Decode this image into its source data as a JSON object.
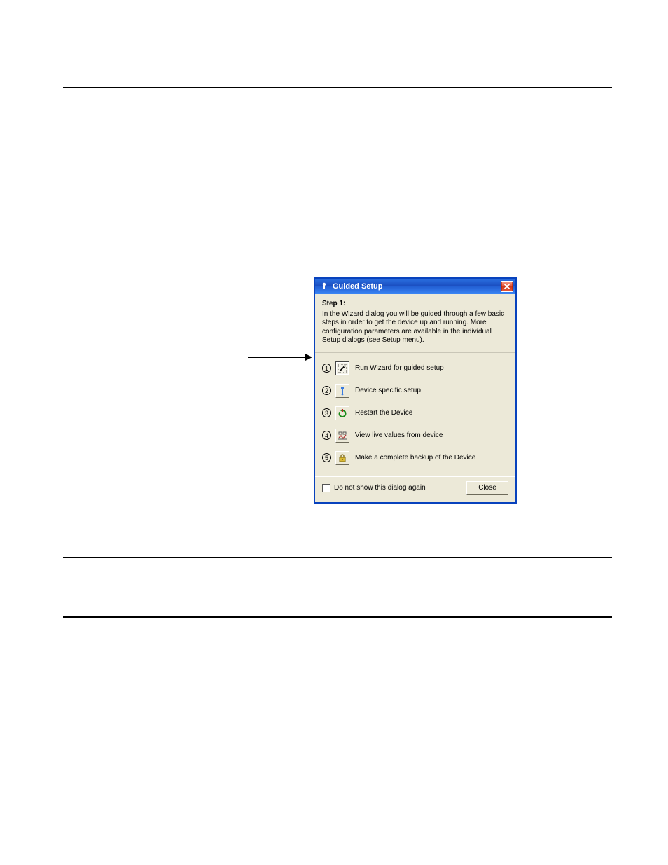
{
  "dialog": {
    "title": "Guided Setup",
    "intro": {
      "heading": "Step 1:",
      "text": "In the Wizard dialog you will be guided through a few basic steps in order to get the device up and running. More configuration parameters are available in the individual Setup dialogs (see Setup menu)."
    },
    "steps": [
      {
        "num": "1",
        "label": "Run Wizard for guided setup"
      },
      {
        "num": "2",
        "label": "Device specific setup"
      },
      {
        "num": "3",
        "label": "Restart the Device"
      },
      {
        "num": "4",
        "label": "View live values from device"
      },
      {
        "num": "5",
        "label": "Make a complete backup of the Device"
      }
    ],
    "checkbox_label": "Do not show this dialog again",
    "close_label": "Close"
  }
}
